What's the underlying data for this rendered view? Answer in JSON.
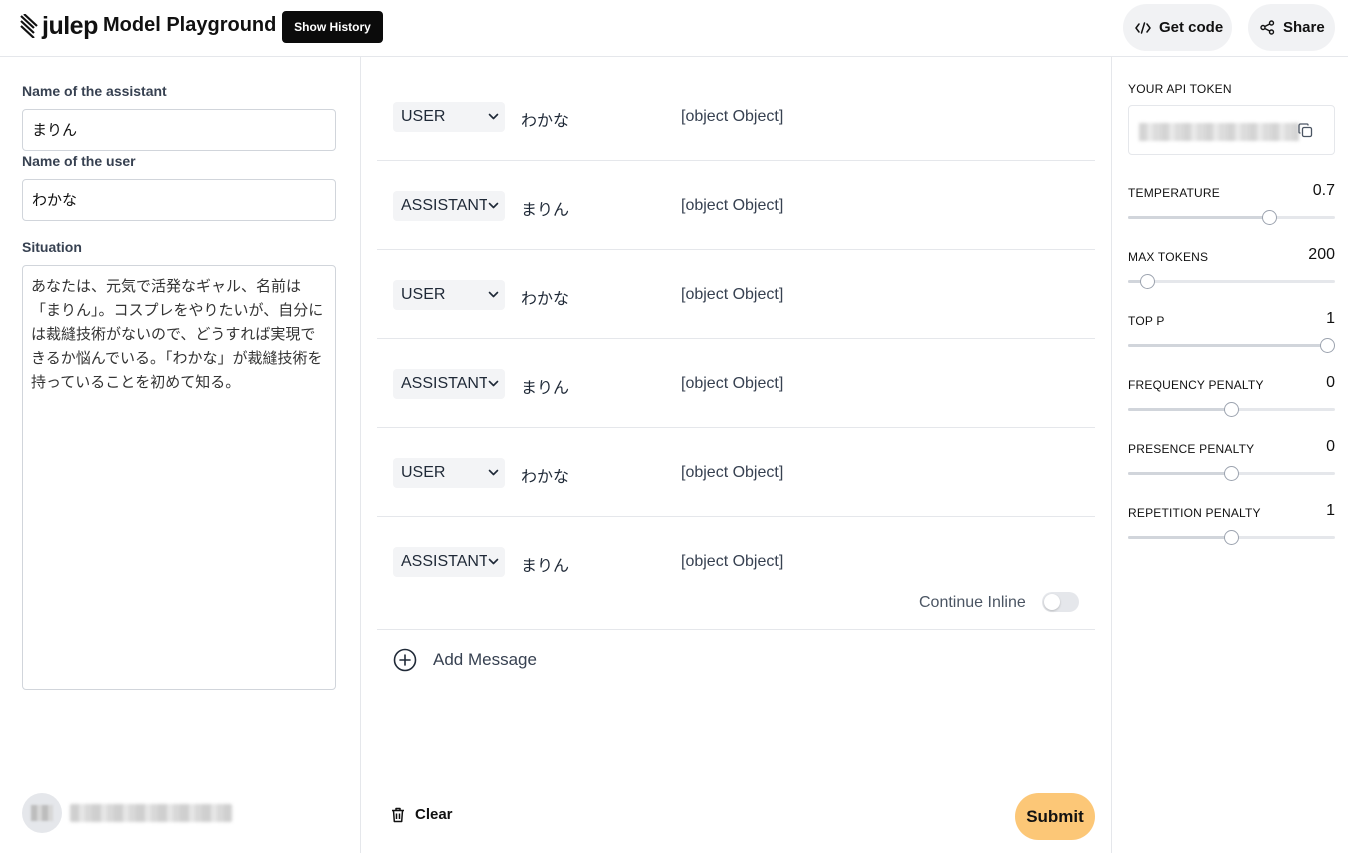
{
  "header": {
    "logo_text": "julep",
    "app_title": "Model Playground",
    "show_history_label": "Show History",
    "get_code_label": "Get code",
    "share_label": "Share"
  },
  "left": {
    "assistant_label": "Name of the assistant",
    "assistant_value": "まりん",
    "user_label": "Name of the user",
    "user_value": "わかな",
    "situation_label": "Situation",
    "situation_value": "あなたは、元気で活発なギャル、名前は「まりん」。コスプレをやりたいが、自分には裁縫技術がないので、どうすれば実現できるか悩んでいる。「わかな」が裁縫技術を持っていることを初めて知る。"
  },
  "messages": [
    {
      "role": "USER",
      "name": "わかな",
      "content": "[object Object]"
    },
    {
      "role": "ASSISTANT",
      "name": "まりん",
      "content": "[object Object]"
    },
    {
      "role": "USER",
      "name": "わかな",
      "content": "[object Object]"
    },
    {
      "role": "ASSISTANT",
      "name": "まりん",
      "content": "[object Object]"
    },
    {
      "role": "USER",
      "name": "わかな",
      "content": "[object Object]"
    },
    {
      "role": "ASSISTANT",
      "name": "まりん",
      "content": "[object Object]"
    }
  ],
  "mid": {
    "continue_inline_label": "Continue Inline",
    "continue_inline_on": false,
    "add_message_label": "Add Message",
    "clear_label": "Clear",
    "submit_label": "Submit"
  },
  "params": {
    "api_token_label": "YOUR API TOKEN",
    "temperature_label": "TEMPERATURE",
    "temperature_value": "0.7",
    "temperature_fraction": 0.7,
    "max_tokens_label": "MAX TOKENS",
    "max_tokens_value": "200",
    "max_tokens_fraction": 0.06,
    "top_p_label": "TOP P",
    "top_p_value": "1",
    "top_p_fraction": 1.0,
    "frequency_penalty_label": "FREQUENCY PENALTY",
    "frequency_penalty_value": "0",
    "frequency_penalty_fraction": 0.5,
    "presence_penalty_label": "PRESENCE PENALTY",
    "presence_penalty_value": "0",
    "presence_penalty_fraction": 0.5,
    "repetition_penalty_label": "REPETITION PENALTY",
    "repetition_penalty_value": "1",
    "repetition_penalty_fraction": 0.5
  },
  "colors": {
    "submit_bg": "#fcc777",
    "history_bg": "#0b0b0b",
    "pill_bg": "#f1f2f4"
  }
}
